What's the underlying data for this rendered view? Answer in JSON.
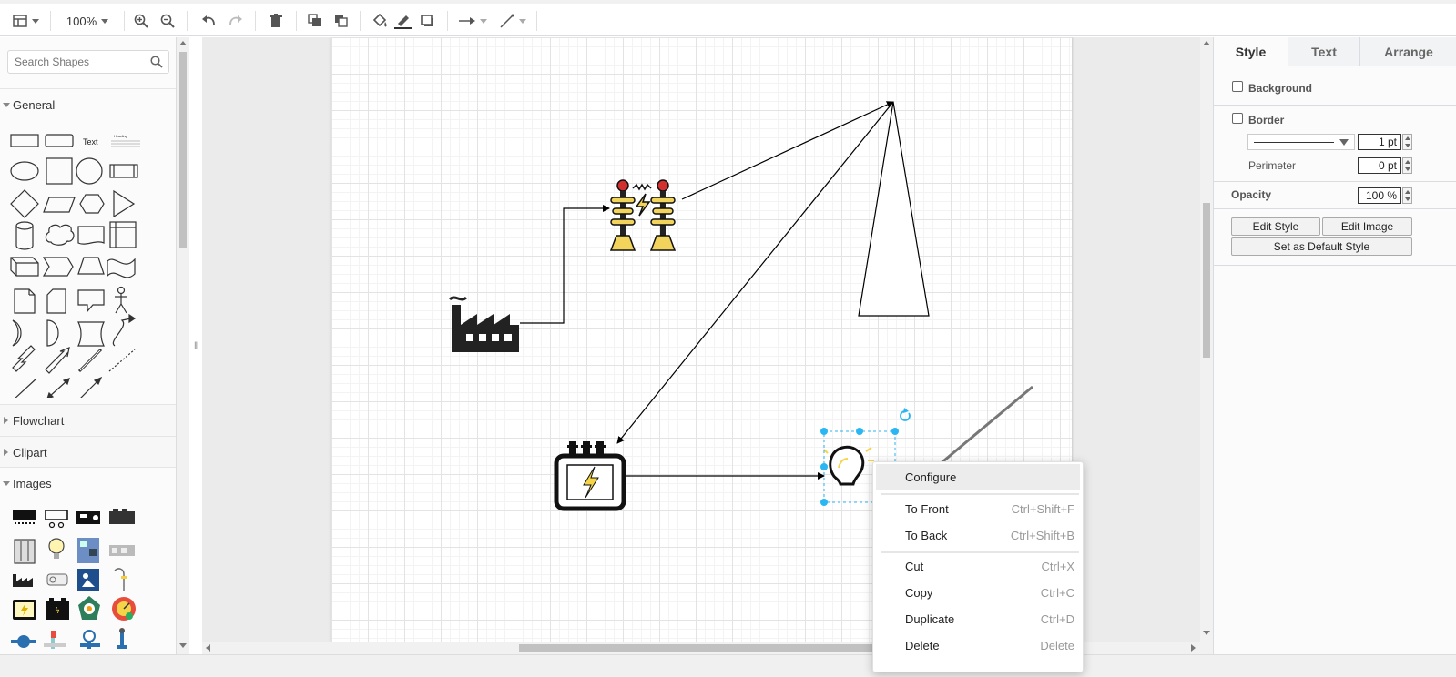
{
  "toolbar": {
    "zoom_value": "100%",
    "icons": [
      "format-panel-icon",
      "zoom-in-icon",
      "zoom-out-icon",
      "undo-icon",
      "redo-icon",
      "delete-icon",
      "to-front-icon",
      "to-back-icon",
      "fill-color-icon",
      "line-color-icon",
      "shadow-icon",
      "connection-icon",
      "waypoints-icon"
    ]
  },
  "sidebar": {
    "search_placeholder": "Search Shapes",
    "sections": {
      "general": "General",
      "flowchart": "Flowchart",
      "clipart": "Clipart",
      "images": "Images"
    },
    "text_shape_label": "Text",
    "heading_shape_label": "Heading"
  },
  "format_panel": {
    "tabs": {
      "style": "Style",
      "text": "Text",
      "arrange": "Arrange"
    },
    "background_label": "Background",
    "background_checked": false,
    "border_label": "Border",
    "border_checked": false,
    "border_width": "1 pt",
    "perimeter_label": "Perimeter",
    "perimeter_value": "0 pt",
    "opacity_label": "Opacity",
    "opacity_value": "100 %",
    "edit_style_button": "Edit Style",
    "edit_image_button": "Edit Image",
    "set_default_button": "Set as Default Style"
  },
  "context_menu": {
    "configure": "Configure",
    "to_front": "To Front",
    "to_front_shortcut": "Ctrl+Shift+F",
    "to_back": "To Back",
    "to_back_shortcut": "Ctrl+Shift+B",
    "cut": "Cut",
    "cut_shortcut": "Ctrl+X",
    "copy": "Copy",
    "copy_shortcut": "Ctrl+C",
    "duplicate": "Duplicate",
    "duplicate_shortcut": "Ctrl+D",
    "delete": "Delete",
    "delete_shortcut": "Delete"
  },
  "colors": {
    "selection": "#29b6f2",
    "bulb_yellow": "#f5d547",
    "tower_yellow": "#f2d35b",
    "tower_red": "#d32f2f"
  }
}
